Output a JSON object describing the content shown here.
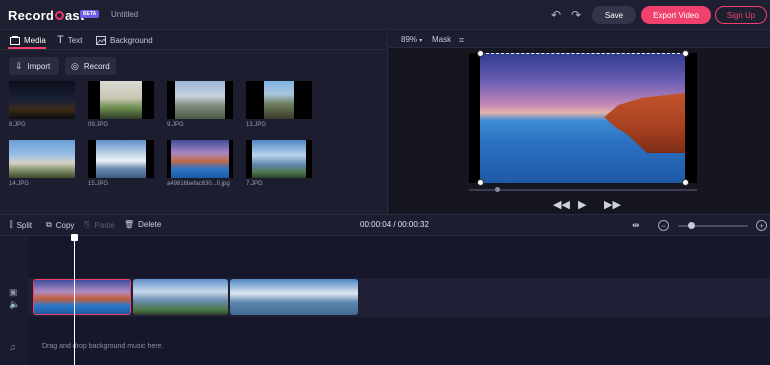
{
  "header": {
    "logo_text_a": "Record",
    "logo_text_b": "ast",
    "beta": "BETA",
    "doc_title": "Untitled",
    "save": "Save",
    "export": "Export Video",
    "signup": "Sign Up"
  },
  "tabs": [
    {
      "label": "Media",
      "icon": "media-icon",
      "active": true
    },
    {
      "label": "Text",
      "icon": "text-icon",
      "active": false
    },
    {
      "label": "Background",
      "icon": "background-icon",
      "active": false
    }
  ],
  "media_actions": {
    "import": "Import",
    "record": "Record"
  },
  "media_items": [
    {
      "label": "8.JPG"
    },
    {
      "label": "09.JPG"
    },
    {
      "label": "9.JPG"
    },
    {
      "label": "13.JPG"
    },
    {
      "label": "14.JPG"
    },
    {
      "label": "15.JPG"
    },
    {
      "label": "a49816befac630...0.jpg"
    },
    {
      "label": "7.JPG"
    }
  ],
  "preview": {
    "zoom": "89%",
    "mask": "Mask"
  },
  "edit_toolbar": {
    "split": "Split",
    "copy": "Copy",
    "paste": "Paste",
    "delete": "Delete",
    "time": "00:00:04 / 00:00:32"
  },
  "timeline": {
    "drop_hint": "Drag and drop background music here."
  },
  "colors": {
    "accent": "#f0416d",
    "background": "#1a1b2b"
  }
}
